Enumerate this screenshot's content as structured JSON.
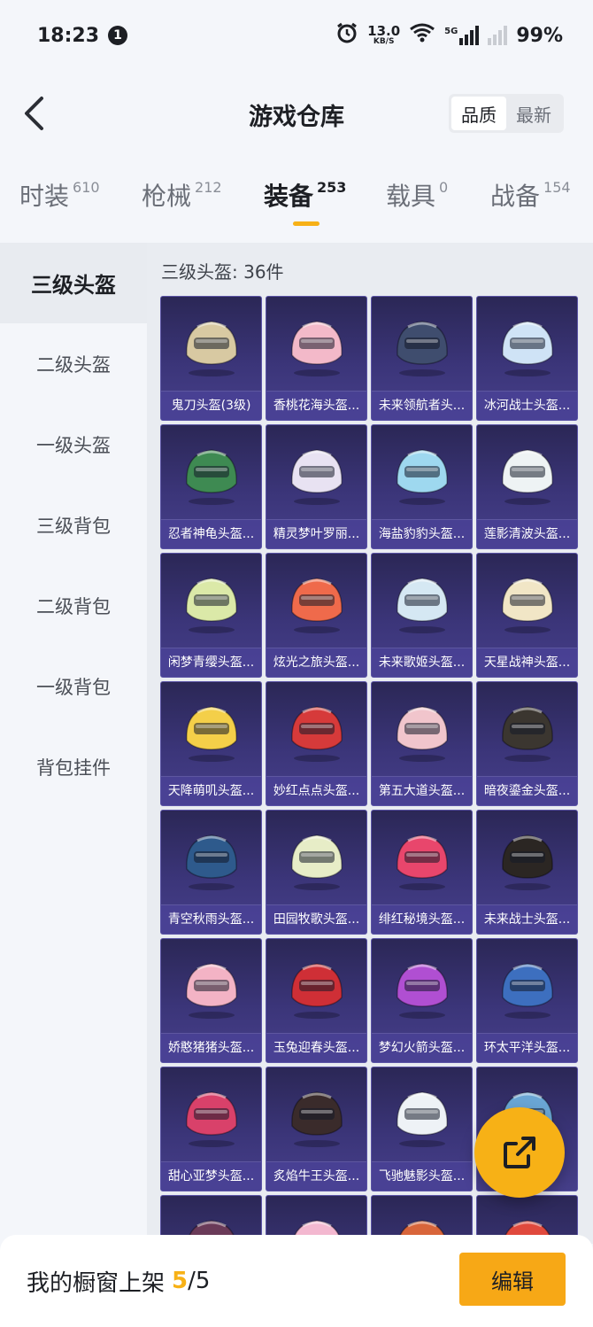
{
  "status_bar": {
    "time": "18:23",
    "notification_count": "1",
    "net_speed_value": "13.0",
    "net_speed_unit": "KB/S",
    "network_label": "5G",
    "battery": "99%"
  },
  "header": {
    "title": "游戏仓库",
    "sort_options": [
      "品质",
      "最新"
    ],
    "sort_selected": "品质"
  },
  "tabs": [
    {
      "label": "时装",
      "count": "610"
    },
    {
      "label": "枪械",
      "count": "212"
    },
    {
      "label": "装备",
      "count": "253",
      "active": true
    },
    {
      "label": "载具",
      "count": "0"
    },
    {
      "label": "战备",
      "count": "154"
    }
  ],
  "sidebar": {
    "items": [
      "三级头盔",
      "二级头盔",
      "一级头盔",
      "三级背包",
      "二级背包",
      "一级背包",
      "背包挂件"
    ],
    "active": "三级头盔"
  },
  "content": {
    "count_line": "三级头盔: 36件",
    "items": [
      {
        "name": "鬼刀头盔(3级)",
        "color": "#d8c9a2"
      },
      {
        "name": "香桃花海头盔...",
        "color": "#f3b9c9"
      },
      {
        "name": "未来领航者头...",
        "color": "#3f4d6e"
      },
      {
        "name": "冰河战士头盔...",
        "color": "#cfe3f6"
      },
      {
        "name": "忍者神龟头盔...",
        "color": "#3e8a52"
      },
      {
        "name": "精灵梦叶罗丽...",
        "color": "#e8e2f2"
      },
      {
        "name": "海盐豹豹头盔...",
        "color": "#9ed8ef"
      },
      {
        "name": "莲影清波头盔...",
        "color": "#eef3f4"
      },
      {
        "name": "闲梦青缨头盔...",
        "color": "#dbe9a8"
      },
      {
        "name": "炫光之旅头盔...",
        "color": "#ef6a4b"
      },
      {
        "name": "未来歌姬头盔...",
        "color": "#d5e8f3"
      },
      {
        "name": "天星战神头盔...",
        "color": "#f1e6c6"
      },
      {
        "name": "天降萌叽头盔...",
        "color": "#f4cf49"
      },
      {
        "name": "妙红点点头盔...",
        "color": "#d63a3a"
      },
      {
        "name": "第五大道头盔...",
        "color": "#f1c5cc"
      },
      {
        "name": "暗夜鎏金头盔...",
        "color": "#3b3630"
      },
      {
        "name": "青空秋雨头盔...",
        "color": "#2e5a8c"
      },
      {
        "name": "田园牧歌头盔...",
        "color": "#e7edc7"
      },
      {
        "name": "绯红秘境头盔...",
        "color": "#e8466c"
      },
      {
        "name": "未来战士头盔...",
        "color": "#2b2623"
      },
      {
        "name": "娇憨猪猪头盔...",
        "color": "#f3b3c5"
      },
      {
        "name": "玉兔迎春头盔...",
        "color": "#cf2f36"
      },
      {
        "name": "梦幻火箭头盔...",
        "color": "#b04fd2"
      },
      {
        "name": "环太平洋头盔...",
        "color": "#3d6fbf"
      },
      {
        "name": "甜心亚梦头盔...",
        "color": "#d9416a"
      },
      {
        "name": "炙焰牛王头盔...",
        "color": "#3a2b2b"
      },
      {
        "name": "飞驰魅影头盔...",
        "color": "#eef2f6"
      },
      {
        "name": "",
        "color": "#6aa6d4"
      },
      {
        "name": "",
        "color": "#6a3a58"
      },
      {
        "name": "",
        "color": "#f3b8d0"
      },
      {
        "name": "",
        "color": "#d8653a"
      },
      {
        "name": "",
        "color": "#e0493d"
      }
    ]
  },
  "fab": {
    "icon": "share-icon"
  },
  "bottom_bar": {
    "label": "我的橱窗上架",
    "count_current": "5",
    "count_sep": "/",
    "count_total": "5",
    "edit_label": "编辑"
  },
  "colors": {
    "accent": "#f7b116",
    "card_bg": "#3b3579"
  }
}
